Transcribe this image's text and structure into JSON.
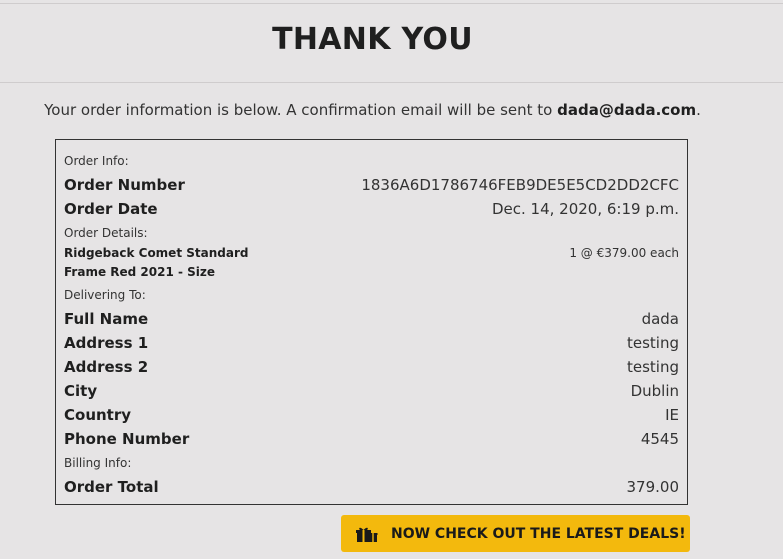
{
  "header": {
    "title": "THANK YOU"
  },
  "intro": {
    "text": "Your order information is below. A confirmation email will be sent to ",
    "email": "dada@dada.com",
    "suffix": "."
  },
  "order": {
    "order_info_label": "Order Info:",
    "order_number_label": "Order Number",
    "order_number": "1836A6D1786746FEB9DE5E5CD2DD2CFC",
    "order_date_label": "Order Date",
    "order_date": "Dec. 14, 2020, 6:19 p.m.",
    "order_details_label": "Order Details:",
    "items": [
      {
        "name": "Ridgeback Comet Standard Frame Red 2021 - Size",
        "quantity_price": "1 @ €379.00 each"
      }
    ],
    "delivering_label": "Delivering To:",
    "full_name_label": "Full Name",
    "full_name": "dada",
    "address1_label": "Address 1",
    "address1": "testing",
    "address2_label": "Address 2",
    "address2": "testing",
    "city_label": "City",
    "city": "Dublin",
    "country_label": "Country",
    "country": "IE",
    "phone_label": "Phone Number",
    "phone": "4545",
    "billing_label": "Billing Info:",
    "total_label": "Order Total",
    "total": "379.00"
  },
  "deals_button": {
    "icon": "gifts-icon",
    "label": "NOW CHECK OUT THE LATEST DEALS!",
    "color": "#f3b90d"
  }
}
